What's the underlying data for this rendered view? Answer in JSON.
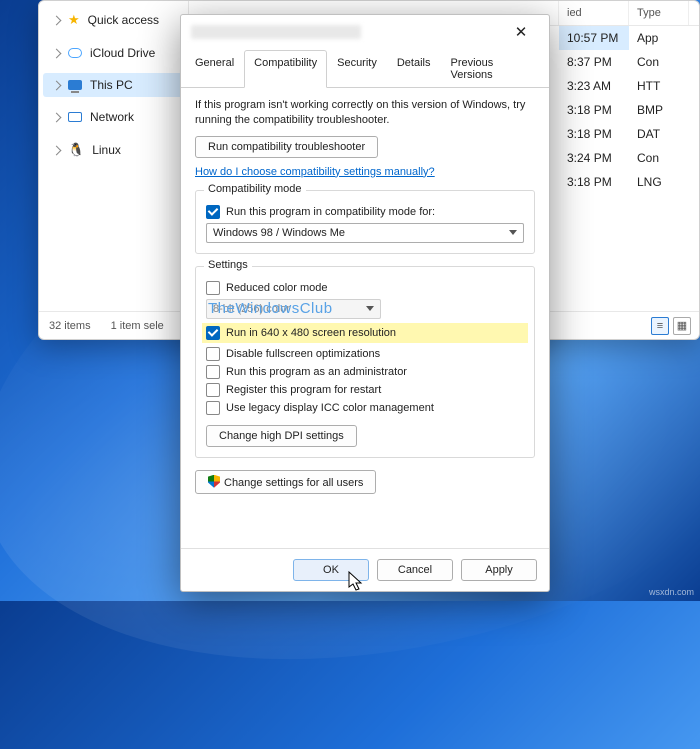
{
  "explorer": {
    "sidebar": [
      {
        "label": "Quick access"
      },
      {
        "label": "iCloud Drive"
      },
      {
        "label": "This PC"
      },
      {
        "label": "Network"
      },
      {
        "label": "Linux"
      }
    ],
    "columns": {
      "date": "ied",
      "type": "Type"
    },
    "rows": [
      {
        "time": "10:57 PM",
        "type": "App",
        "sel": true
      },
      {
        "time": "8:37 PM",
        "type": "Con"
      },
      {
        "time": "3:23 AM",
        "type": "HTT"
      },
      {
        "time": "3:18 PM",
        "type": "BMP"
      },
      {
        "time": "3:18 PM",
        "type": "DAT"
      },
      {
        "time": "3:24 PM",
        "type": "Con"
      },
      {
        "time": "3:18 PM",
        "type": "LNG"
      }
    ],
    "status_items": "32 items",
    "status_sel": "1 item sele"
  },
  "dialog": {
    "tabs": [
      "General",
      "Compatibility",
      "Security",
      "Details",
      "Previous Versions"
    ],
    "intro": "If this program isn't working correctly on this version of Windows, try running the compatibility troubleshooter.",
    "run_troubleshooter": "Run compatibility troubleshooter",
    "link": "How do I choose compatibility settings manually?",
    "compat_group": "Compatibility mode",
    "compat_check": "Run this program in compatibility mode for:",
    "compat_value": "Windows 98 / Windows Me",
    "settings_group": "Settings",
    "reduced_color": "Reduced color mode",
    "color_value": "8-bit (256) color",
    "run_640": "Run in 640 x 480 screen resolution",
    "disable_fs": "Disable fullscreen optimizations",
    "run_admin": "Run this program as an administrator",
    "register": "Register this program for restart",
    "legacy_icc": "Use legacy display ICC color management",
    "dpi_btn": "Change high DPI settings",
    "all_users": "Change settings for all users",
    "ok": "OK",
    "cancel": "Cancel",
    "apply": "Apply"
  },
  "watermark": "TheWindowsClub",
  "site": "wsxdn.com"
}
